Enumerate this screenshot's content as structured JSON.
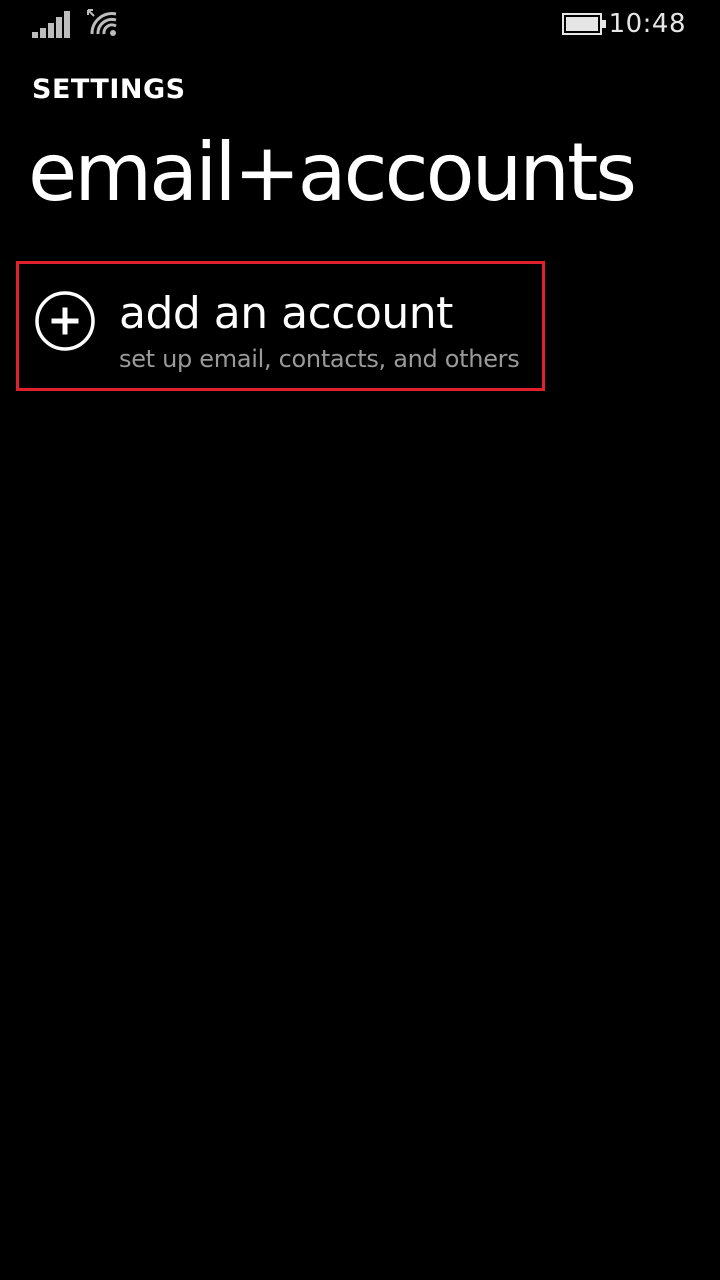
{
  "status_bar": {
    "time": "10:48",
    "icons": [
      "signal-strength-icon",
      "wifi-icon",
      "battery-icon"
    ]
  },
  "header": {
    "app_label": "SETTINGS",
    "page_title": "email+accounts"
  },
  "list": {
    "items": [
      {
        "icon": "add-circle-icon",
        "title": "add an account",
        "subtitle": "set up email, contacts, and others"
      }
    ]
  },
  "colors": {
    "background": "#000000",
    "text_primary": "#ffffff",
    "text_secondary": "#9a9a9a",
    "highlight_border": "#e0202e"
  }
}
